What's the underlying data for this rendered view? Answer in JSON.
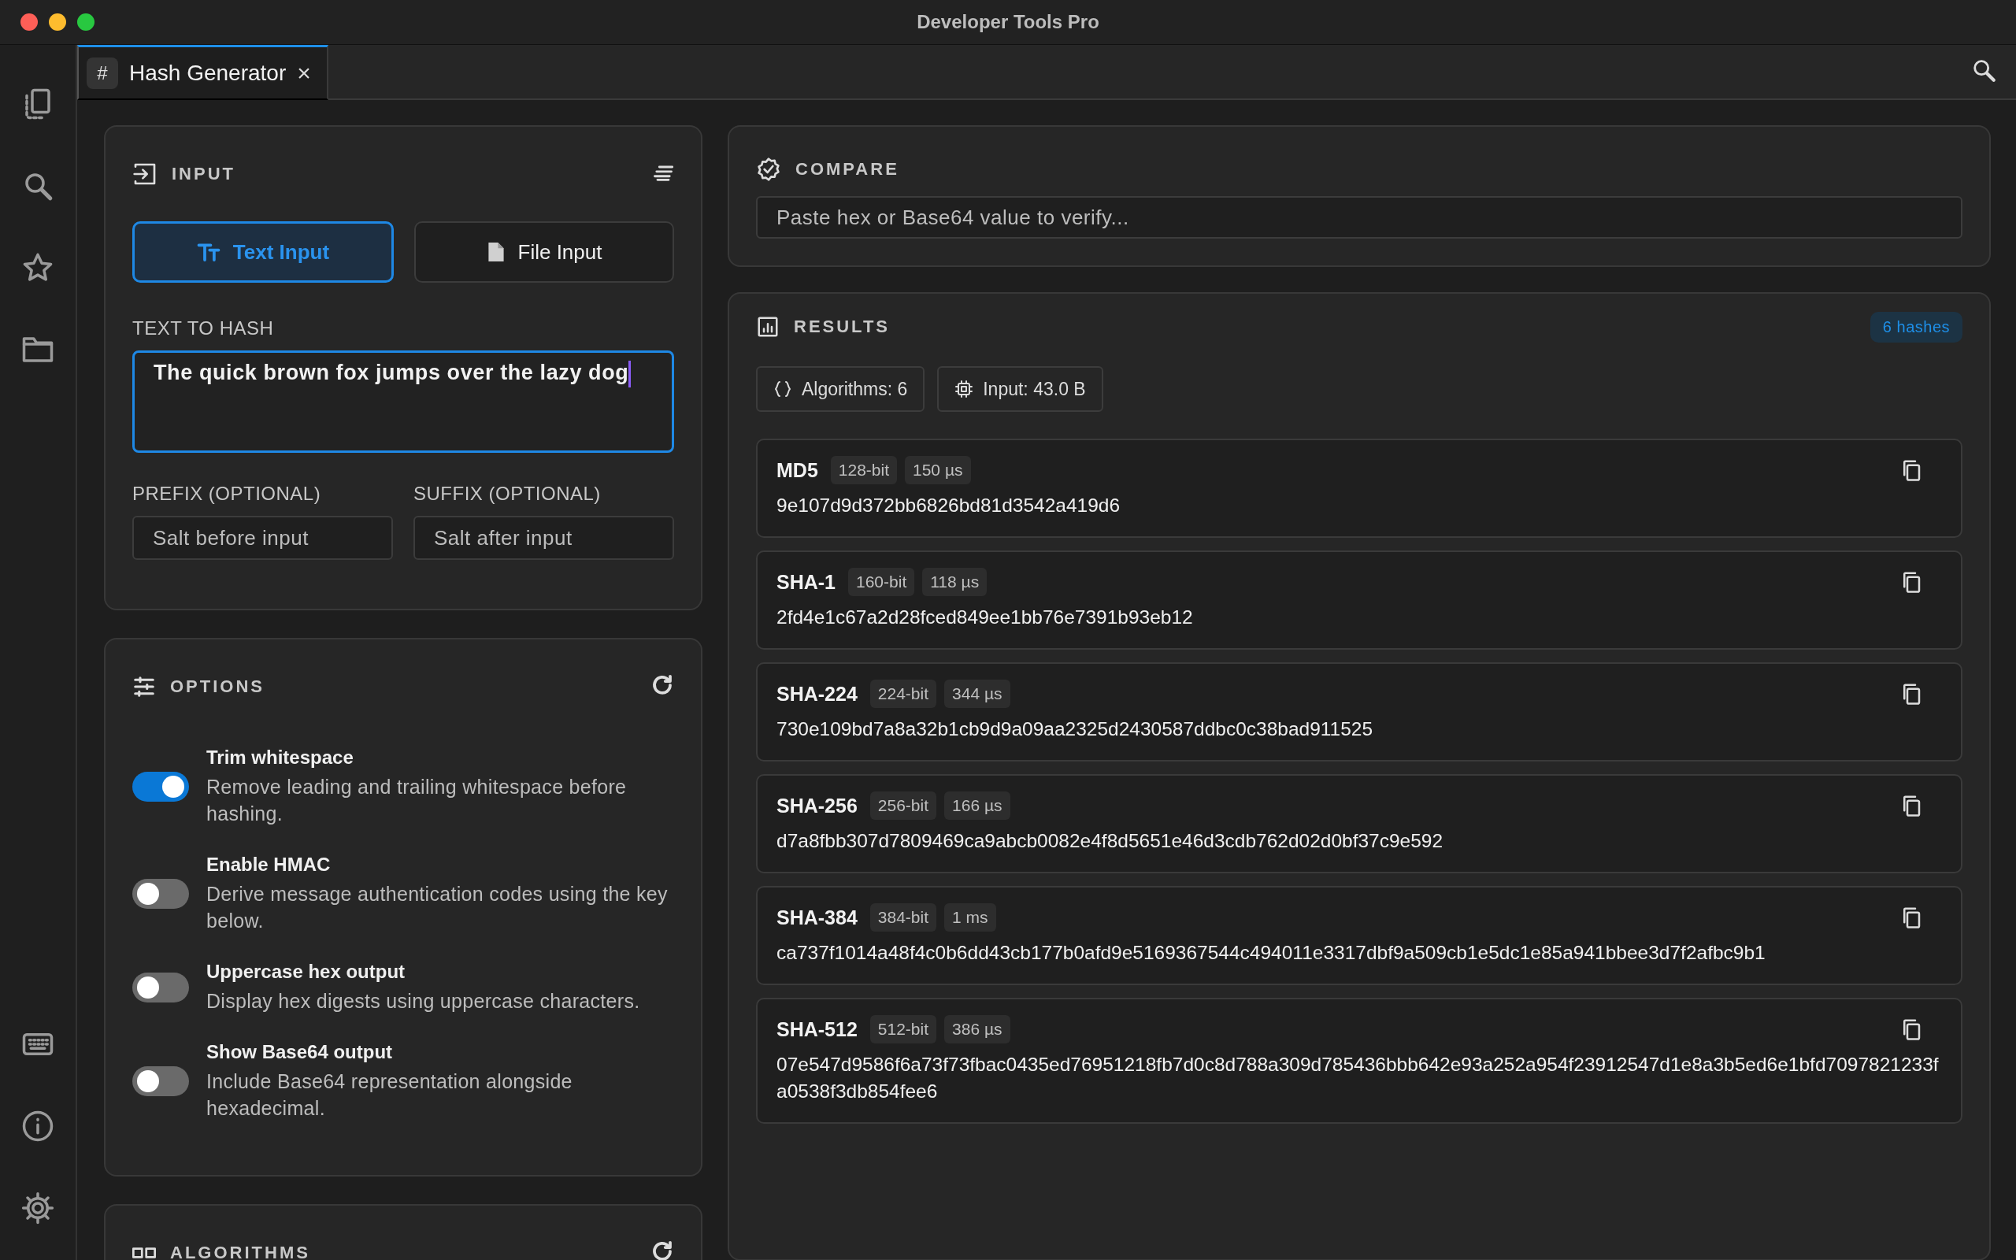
{
  "window": {
    "title": "Developer Tools Pro"
  },
  "tabs": [
    {
      "icon": "#",
      "label": "Hash Generator",
      "close": "×",
      "selected": true
    }
  ],
  "input": {
    "title": "INPUT",
    "modes": [
      {
        "kind": "text",
        "label": "Text Input",
        "selected": true
      },
      {
        "kind": "file",
        "label": "File Input",
        "selected": false
      }
    ],
    "text_label": "TEXT TO HASH",
    "text_value": "The quick brown fox jumps over the lazy dog",
    "fields": [
      {
        "label": "PREFIX (OPTIONAL)",
        "placeholder": "Salt before input"
      },
      {
        "label": "SUFFIX (OPTIONAL)",
        "placeholder": "Salt after input"
      }
    ]
  },
  "options": {
    "title": "OPTIONS",
    "items": [
      {
        "title": "Trim whitespace",
        "description": "Remove leading and trailing whitespace before hashing.",
        "on": true
      },
      {
        "title": "Enable HMAC",
        "description": "Derive message authentication codes using the key below.",
        "on": false
      },
      {
        "title": "Uppercase hex output",
        "description": "Display hex digests using uppercase characters.",
        "on": false
      },
      {
        "title": "Show Base64 output",
        "description": "Include Base64 representation alongside hexadecimal.",
        "on": false
      }
    ]
  },
  "algorithms": {
    "title": "ALGORITHMS"
  },
  "compare": {
    "title": "COMPARE",
    "placeholder": "Paste hex or Base64 value to verify..."
  },
  "results": {
    "title": "RESULTS",
    "badge": "6 hashes",
    "stats": [
      {
        "kind": "braces",
        "label": "Algorithms: 6"
      },
      {
        "kind": "chip",
        "label": "Input: 43.0 B"
      }
    ],
    "hashes": [
      {
        "name": "MD5",
        "bits": "128-bit",
        "time": "150 µs",
        "value": "9e107d9d372bb6826bd81d3542a419d6"
      },
      {
        "name": "SHA-1",
        "bits": "160-bit",
        "time": "118 µs",
        "value": "2fd4e1c67a2d28fced849ee1bb76e7391b93eb12"
      },
      {
        "name": "SHA-224",
        "bits": "224-bit",
        "time": "344 µs",
        "value": "730e109bd7a8a32b1cb9d9a09aa2325d2430587ddbc0c38bad911525"
      },
      {
        "name": "SHA-256",
        "bits": "256-bit",
        "time": "166 µs",
        "value": "d7a8fbb307d7809469ca9abcb0082e4f8d5651e46d3cdb762d02d0bf37c9e592"
      },
      {
        "name": "SHA-384",
        "bits": "384-bit",
        "time": "1 ms",
        "value": "ca737f1014a48f4c0b6dd43cb177b0afd9e5169367544c494011e3317dbf9a509cb1e5dc1e85a941bbee3d7f2afbc9b1"
      },
      {
        "name": "SHA-512",
        "bits": "512-bit",
        "time": "386 µs",
        "value": "07e547d9586f6a73f73fbac0435ed76951218fb7d0c8d788a309d785436bbb642e93a252a954f23912547d1e8a3b5ed6e1bfd7097821233fa0538f3db854fee6"
      }
    ]
  }
}
